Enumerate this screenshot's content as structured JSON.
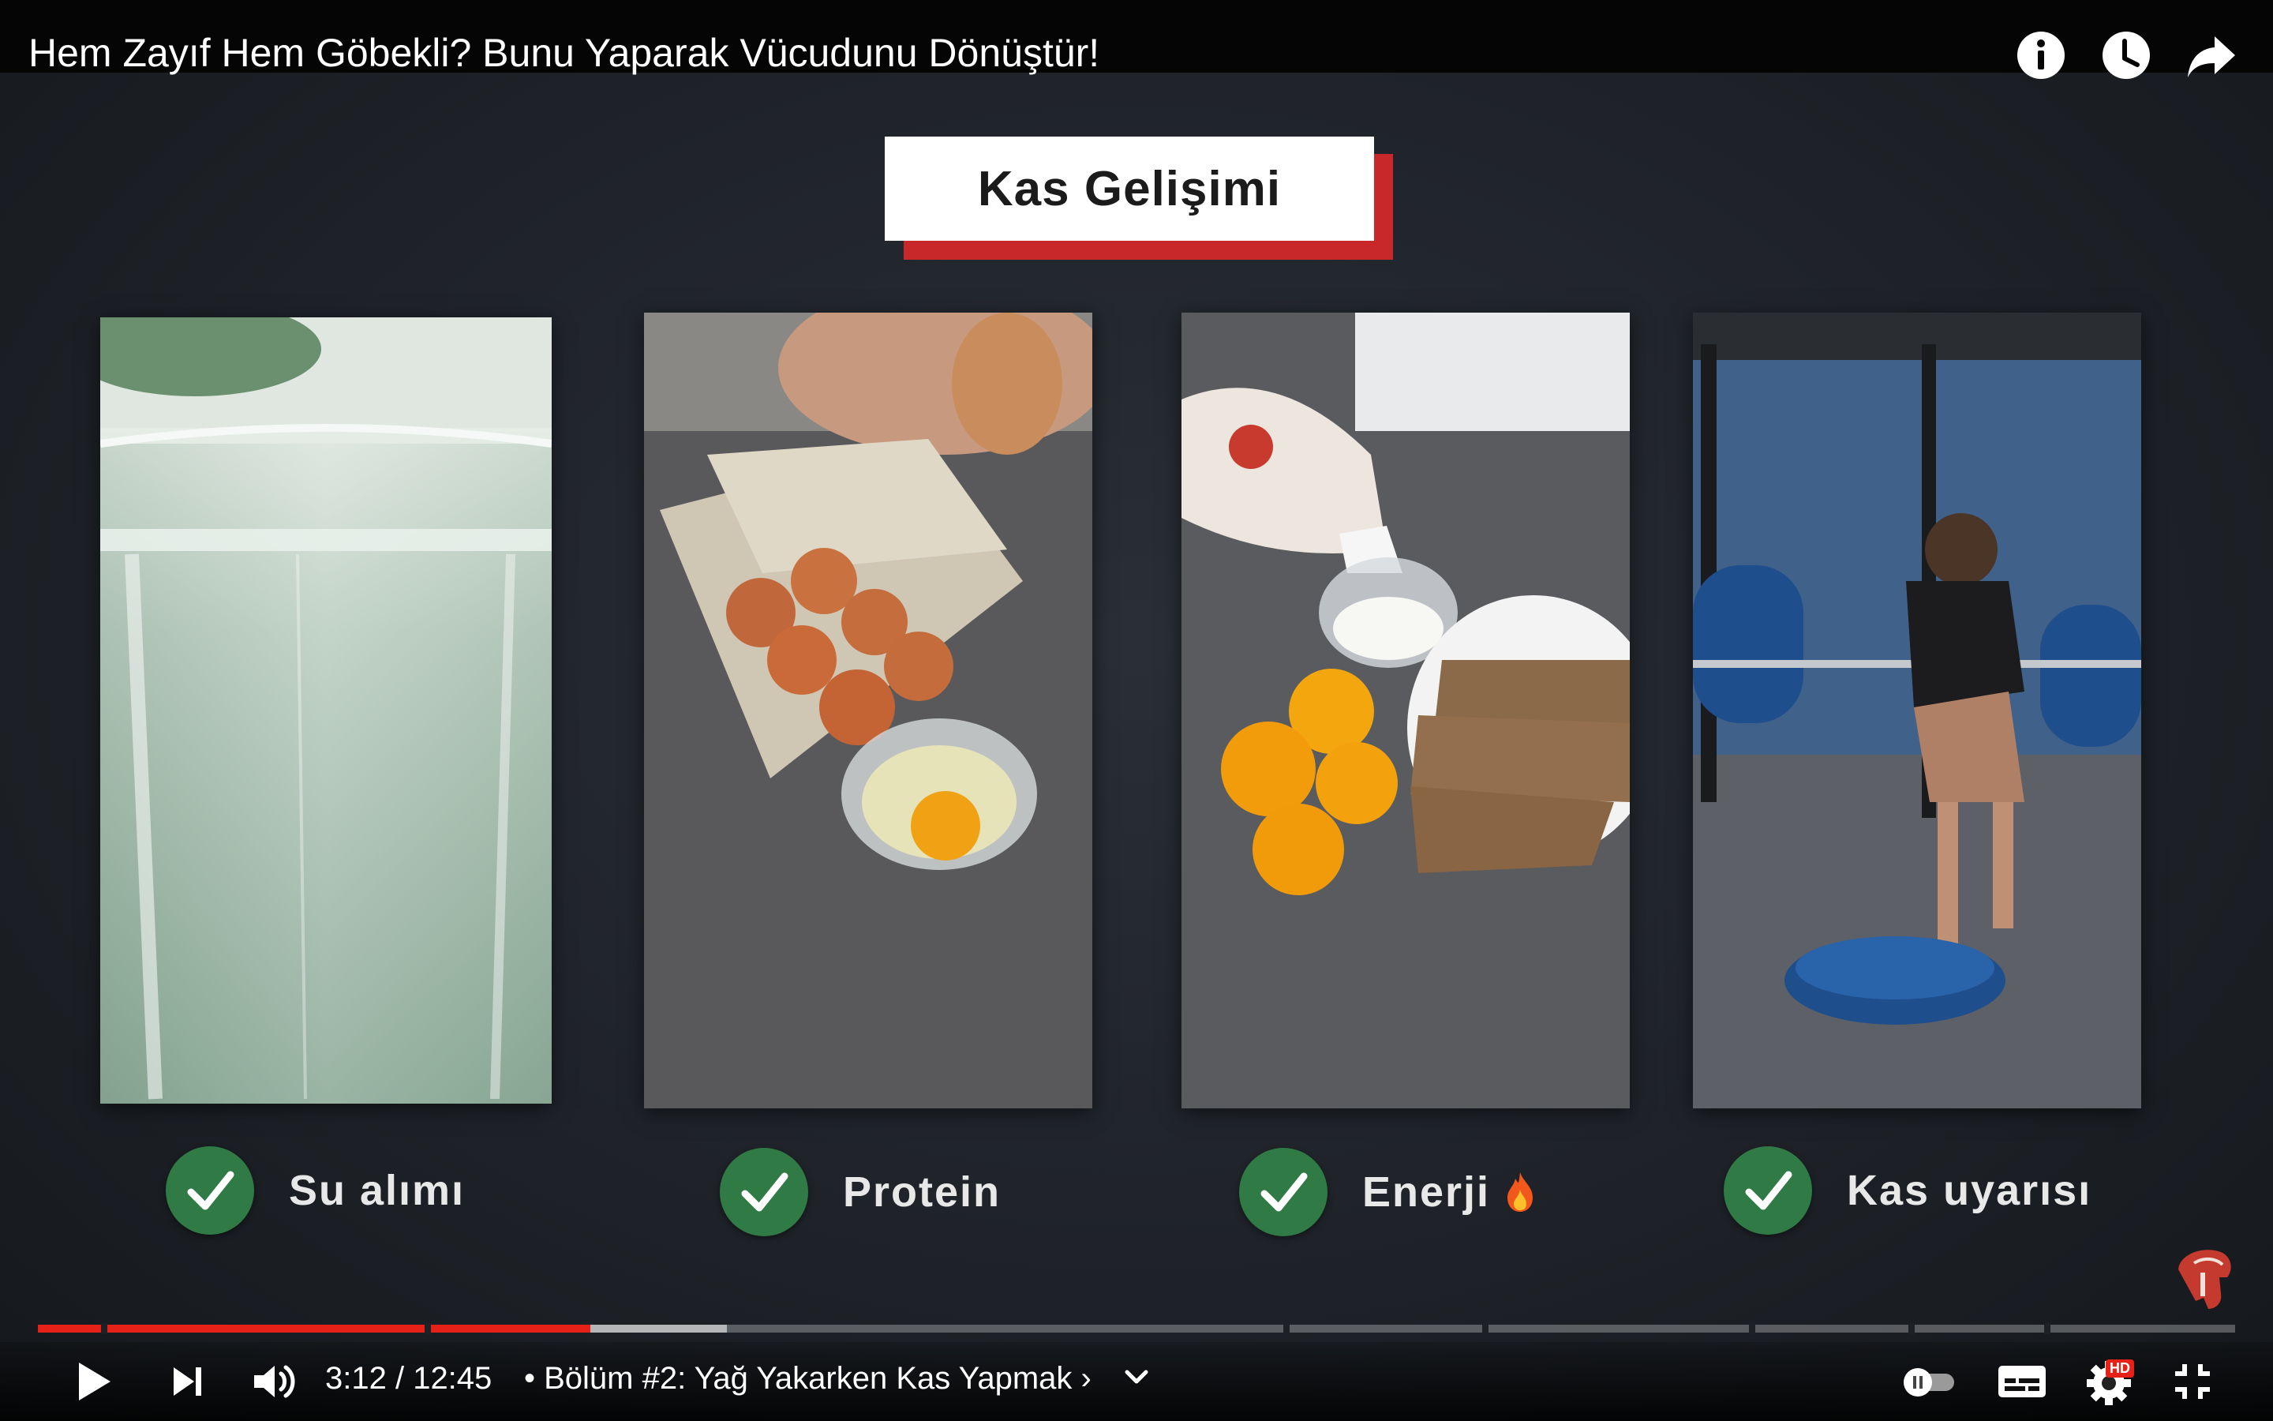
{
  "video": {
    "title": "Hem Zayıf Hem Göbekli? Bunu Yaparak Vücudunu Dönüştür!"
  },
  "heading": "Kas Gelişimi",
  "panels": [
    {
      "label": "Su alımı",
      "image": "water-glass"
    },
    {
      "label": "Protein",
      "image": "eggs"
    },
    {
      "label": "Enerji",
      "image": "bread-oranges-rice",
      "emoji": "flame-icon"
    },
    {
      "label": "Kas uyarısı",
      "image": "barbell-row"
    }
  ],
  "player": {
    "time_display": "3:12 / 12:45",
    "chapter": "• Bölüm #2: Yağ Yakarken Kas Yapmak ›",
    "progress_fraction": 0.251,
    "buffered_fraction": 0.32,
    "hd_badge": "HD",
    "colors": {
      "played": "#e62117",
      "accent_green": "#2f7a45",
      "heading_shadow": "#c8282a"
    }
  }
}
